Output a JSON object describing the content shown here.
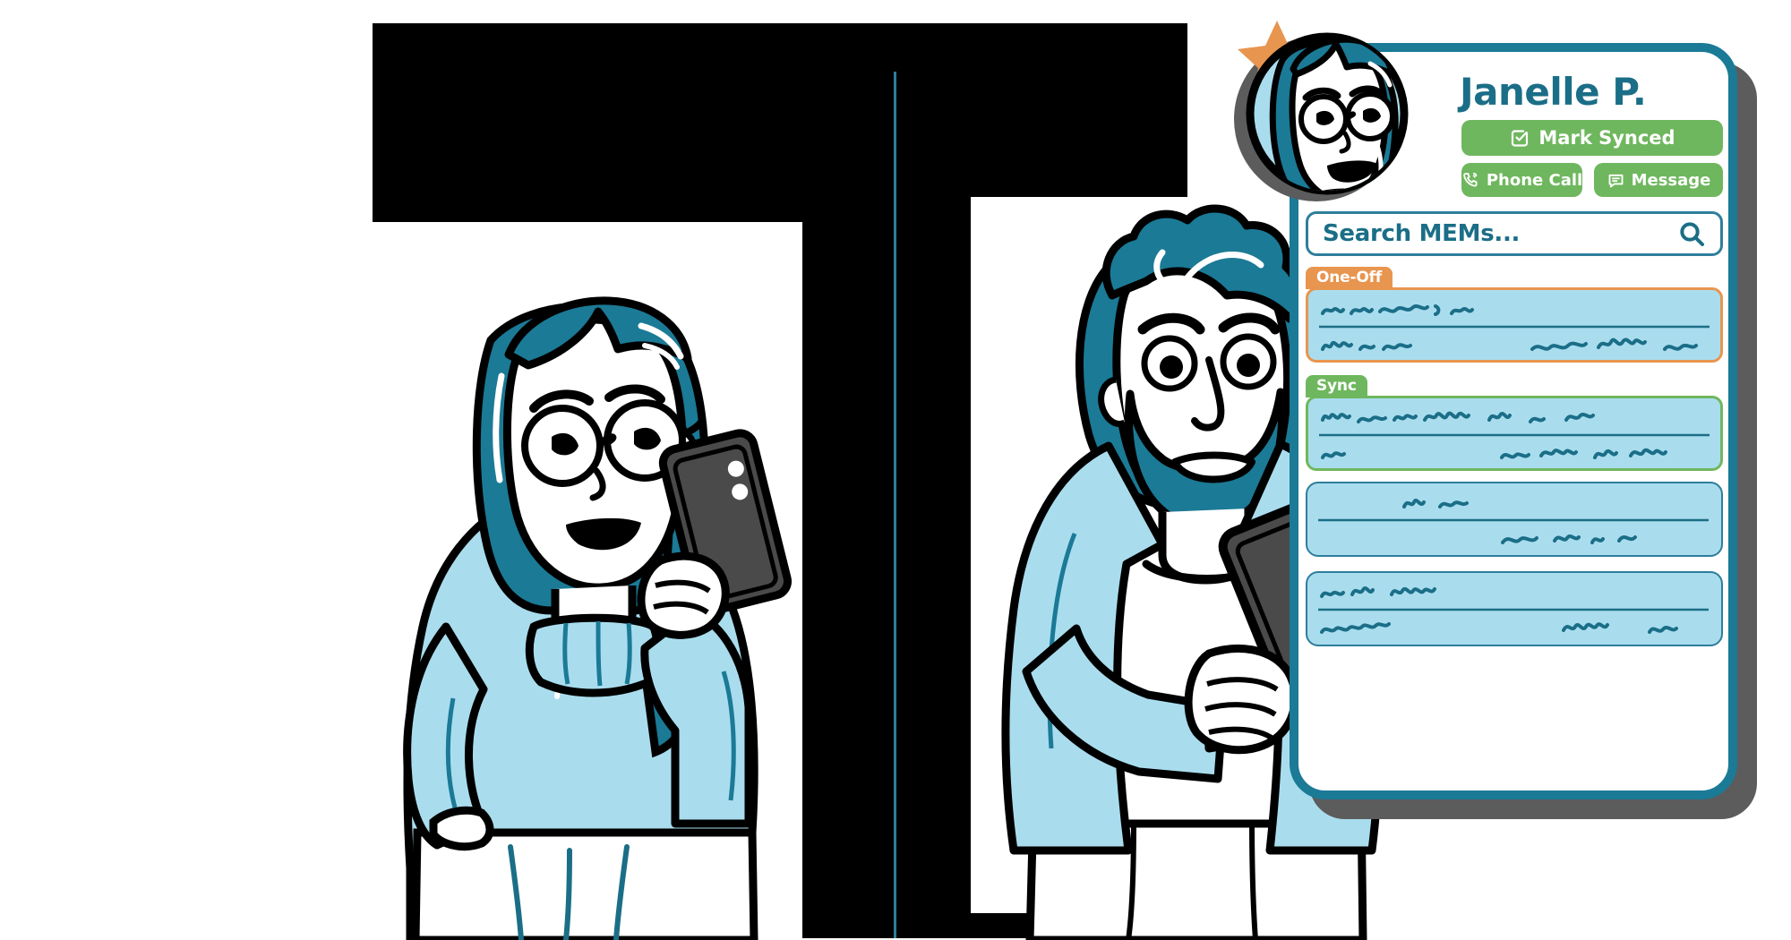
{
  "scene": {
    "type": "illustration-mockup",
    "description": "Two cartoon people using phones beside a mobile app mockup"
  },
  "colors": {
    "accent_teal": "#1b6e87",
    "device_border_teal": "#1b7a96",
    "green": "#6fb75e",
    "orange": "#e8954f",
    "card_blue": "#a9ddee",
    "shadow_gray": "#5c5c5c",
    "frame_black": "#000000",
    "hair_teal": "#1b7a96",
    "sweater_blue": "#a9ddee",
    "phone_dark": "#4a4a4a"
  },
  "phone": {
    "contact": {
      "name": "Janelle P.",
      "avatar_alt": "Woman with teal hair and round glasses",
      "badge_icon": "star-icon"
    },
    "actions": {
      "mark_synced": {
        "label": "Mark Synced",
        "icon": "check-square-icon"
      },
      "phone_call": {
        "label": "Phone Call",
        "icon": "phone-ring-icon"
      },
      "message": {
        "label": "Message",
        "icon": "chat-bubble-icon"
      }
    },
    "search": {
      "placeholder": "Search MEMs...",
      "value": "Search MEMs...",
      "icon": "search-icon"
    },
    "mem_groups": [
      {
        "tag": "One-Off",
        "tag_color": "#e8954f",
        "border": "orange",
        "lines": 2
      },
      {
        "tag": "Sync",
        "tag_color": "#6fb75e",
        "border": "green",
        "lines": 2
      }
    ],
    "mem_items": [
      {
        "tag": null,
        "border": "blue",
        "lines": 2
      },
      {
        "tag": null,
        "border": "blue",
        "lines": 2
      }
    ]
  },
  "illustrations": {
    "woman": {
      "alt": "Woman with teal hair, round glasses and light blue turtleneck sweater holding a phone to her ear",
      "hand_pose": "hand-on-hip"
    },
    "man": {
      "alt": "Bearded man with curly teal hair wearing a light blue blazer over a white tee, holding a phone",
      "hand_pose": "holding-phone"
    }
  }
}
